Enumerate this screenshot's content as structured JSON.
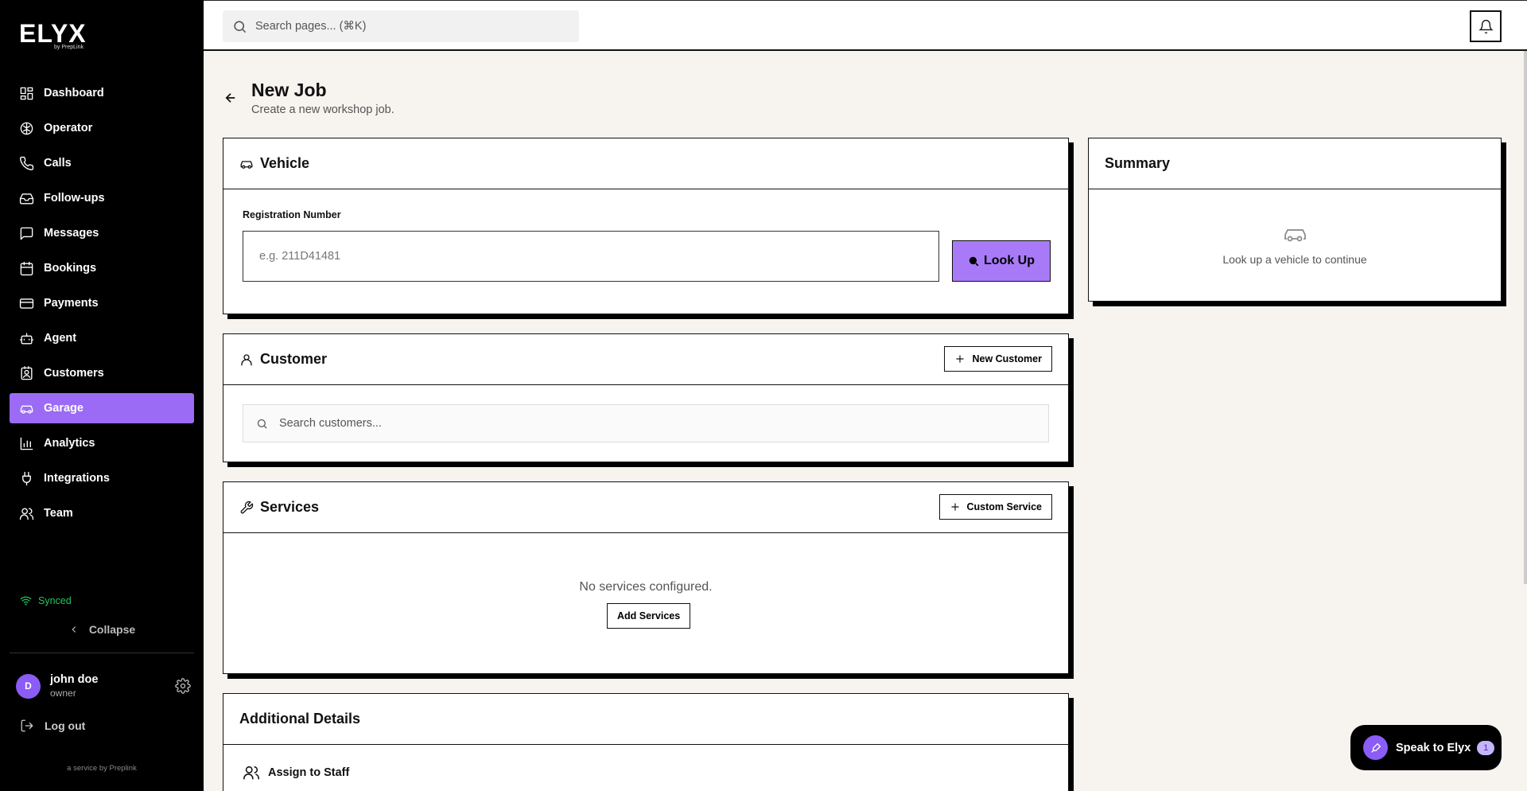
{
  "brand": {
    "name": "ELYX",
    "tagline": "by PrepLink"
  },
  "sidebar": {
    "items": [
      {
        "label": "Dashboard",
        "icon": "dashboard-icon"
      },
      {
        "label": "Operator",
        "icon": "brain-icon"
      },
      {
        "label": "Calls",
        "icon": "phone-icon"
      },
      {
        "label": "Follow-ups",
        "icon": "inbox-icon"
      },
      {
        "label": "Messages",
        "icon": "message-icon"
      },
      {
        "label": "Bookings",
        "icon": "calendar-icon"
      },
      {
        "label": "Payments",
        "icon": "card-icon"
      },
      {
        "label": "Agent",
        "icon": "robot-icon"
      },
      {
        "label": "Customers",
        "icon": "contact-icon"
      },
      {
        "label": "Garage",
        "icon": "car-icon",
        "active": true
      },
      {
        "label": "Analytics",
        "icon": "chart-icon"
      },
      {
        "label": "Integrations",
        "icon": "plug-icon"
      },
      {
        "label": "Team",
        "icon": "users-icon"
      }
    ],
    "sync_status": "Synced",
    "collapse_label": "Collapse",
    "user": {
      "initial": "D",
      "name": "john doe",
      "role": "owner"
    },
    "logout_label": "Log out",
    "footer": "a service by Preplink"
  },
  "topbar": {
    "search_placeholder": "Search pages... (⌘K)"
  },
  "page": {
    "title": "New Job",
    "subtitle": "Create a new workshop job."
  },
  "vehicle": {
    "title": "Vehicle",
    "reg_label": "Registration Number",
    "reg_placeholder": "e.g. 211D41481",
    "lookup_label": "Look Up"
  },
  "customer": {
    "title": "Customer",
    "new_label": "New Customer",
    "search_placeholder": "Search customers..."
  },
  "services": {
    "title": "Services",
    "custom_label": "Custom Service",
    "empty_text": "No services configured.",
    "add_label": "Add Services"
  },
  "additional": {
    "title": "Additional Details",
    "assign_label": "Assign to Staff"
  },
  "summary": {
    "title": "Summary",
    "empty_text": "Look up a vehicle to continue"
  },
  "assistant": {
    "label": "Speak to Elyx",
    "badge": "1"
  },
  "colors": {
    "accent": "#9b6bf5",
    "sidebar_bg": "#000000",
    "page_bg": "#f7f3ef",
    "synced": "#22c55e"
  }
}
